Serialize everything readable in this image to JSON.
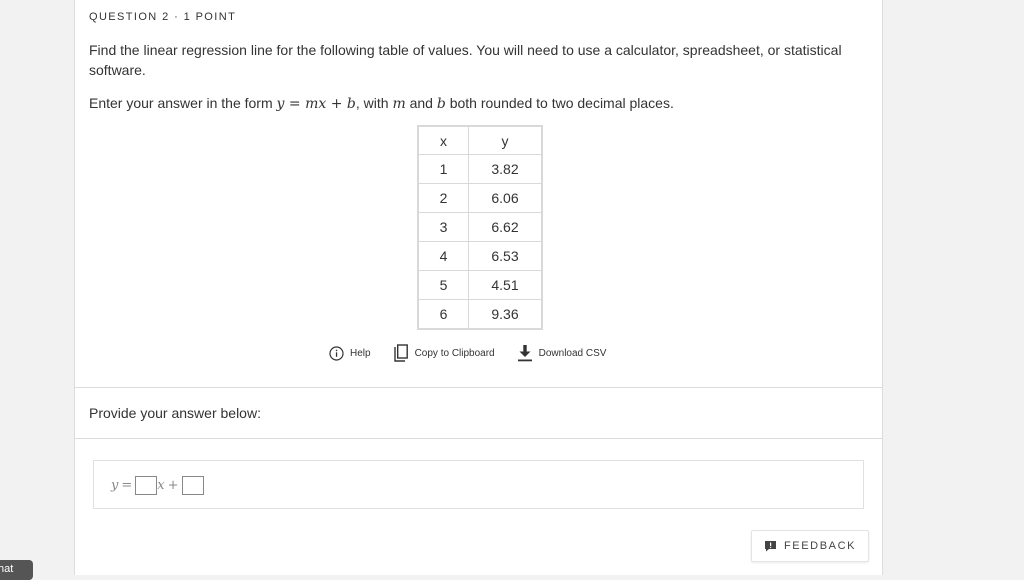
{
  "question": {
    "header": "QUESTION 2 · 1 POINT",
    "text": "Find the linear regression line for the following table of values. You will need to use a calculator, spreadsheet, or statistical software.",
    "form_prefix": "Enter your answer in the form",
    "form_eq_y": "y",
    "form_eq_rest": "= mx + b",
    "form_mid1": ", with",
    "form_m": "m",
    "form_mid2": "and",
    "form_b": "b",
    "form_suffix": "both rounded to two decimal places."
  },
  "table": {
    "headers": [
      "x",
      "y"
    ],
    "rows": [
      [
        "1",
        "3.82"
      ],
      [
        "2",
        "6.06"
      ],
      [
        "3",
        "6.62"
      ],
      [
        "4",
        "6.53"
      ],
      [
        "5",
        "4.51"
      ],
      [
        "6",
        "9.36"
      ]
    ]
  },
  "tools": {
    "help": "Help",
    "copy": "Copy to Clipboard",
    "download": "Download CSV"
  },
  "answer": {
    "prompt": "Provide your answer below:",
    "eq_y": "y",
    "eq_equals": "=",
    "eq_x": "x",
    "eq_plus": "+"
  },
  "feedback_label": "FEEDBACK",
  "chat_label": "hat",
  "colors": {
    "page_bg": "#f2f2f2",
    "card_bg": "#ffffff",
    "border": "#dcdcdc",
    "text": "#333333"
  }
}
